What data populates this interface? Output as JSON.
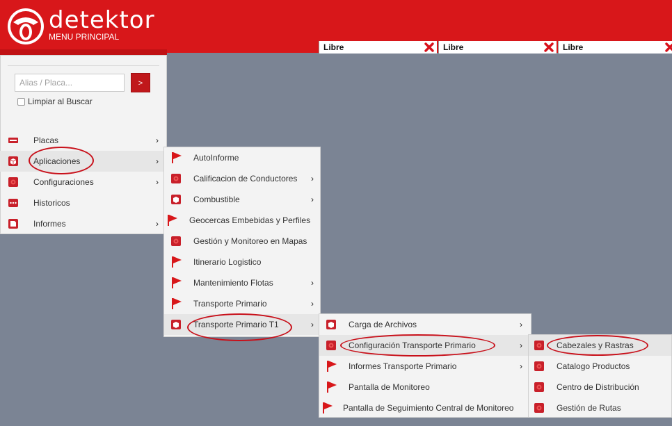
{
  "header": {
    "brand": "detektor",
    "subtitle": "MENU PRINCIPAL"
  },
  "tabs": [
    {
      "label": "Libre"
    },
    {
      "label": "Libre"
    },
    {
      "label": "Libre"
    }
  ],
  "search": {
    "placeholder": "Alias / Placa...",
    "button": ">",
    "clear_label": "Limpiar al Buscar"
  },
  "main_menu": [
    {
      "label": "Placas",
      "icon": "plate-icon",
      "has_submenu": true
    },
    {
      "label": "Aplicaciones",
      "icon": "cube-icon",
      "has_submenu": true,
      "selected": true
    },
    {
      "label": "Configuraciones",
      "icon": "gear-box-icon",
      "has_submenu": true
    },
    {
      "label": "Historicos",
      "icon": "dots-icon",
      "has_submenu": false
    },
    {
      "label": "Informes",
      "icon": "folder-icon",
      "has_submenu": true
    }
  ],
  "apps_menu": [
    {
      "label": "AutoInforme",
      "icon": "flag-icon",
      "has_submenu": false
    },
    {
      "label": "Calificacion de Conductores",
      "icon": "gear-box-icon",
      "has_submenu": true
    },
    {
      "label": "Combustible",
      "icon": "cube-icon",
      "has_submenu": true
    },
    {
      "label": "Geocercas Embebidas y Perfiles",
      "icon": "flag-icon",
      "has_submenu": false
    },
    {
      "label": "Gestión y Monitoreo en Mapas",
      "icon": "gear-box-icon",
      "has_submenu": false
    },
    {
      "label": "Itinerario Logistico",
      "icon": "flag-icon",
      "has_submenu": false
    },
    {
      "label": "Mantenimiento Flotas",
      "icon": "flag-icon",
      "has_submenu": true
    },
    {
      "label": "Transporte Primario",
      "icon": "flag-icon",
      "has_submenu": true
    },
    {
      "label": "Transporte Primario T1",
      "icon": "cube-icon",
      "has_submenu": true,
      "selected": true
    }
  ],
  "t1_menu": [
    {
      "label": "Carga de Archivos",
      "icon": "cube-icon",
      "has_submenu": true
    },
    {
      "label": "Configuración Transporte Primario",
      "icon": "gear-box-icon",
      "has_submenu": true,
      "selected": true
    },
    {
      "label": "Informes Transporte Primario",
      "icon": "flag-icon",
      "has_submenu": true
    },
    {
      "label": "Pantalla de Monitoreo",
      "icon": "flag-icon",
      "has_submenu": false
    },
    {
      "label": "Pantalla de Seguimiento Central de Monitoreo",
      "icon": "flag-icon",
      "has_submenu": false
    }
  ],
  "config_menu": [
    {
      "label": "Cabezales y Rastras",
      "icon": "gear-box-icon",
      "selected": true
    },
    {
      "label": "Catalogo Productos",
      "icon": "gear-box-icon"
    },
    {
      "label": "Centro de Distribución",
      "icon": "gear-box-icon"
    },
    {
      "label": "Gestión de Rutas",
      "icon": "gear-box-icon"
    }
  ],
  "colors": {
    "brand_red": "#d8171a",
    "background": "#7b8494",
    "menu_bg": "#f3f3f3",
    "highlight": "#c8101a"
  }
}
